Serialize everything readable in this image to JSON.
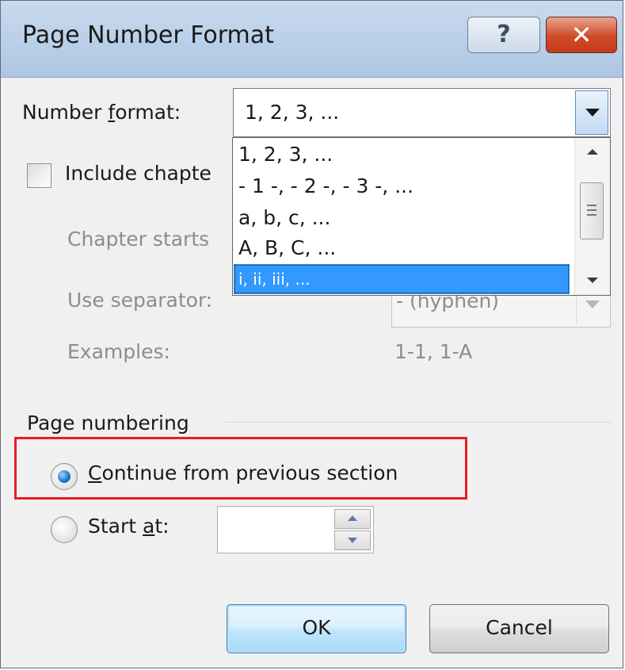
{
  "window": {
    "title": "Page Number Format"
  },
  "titlebar": {
    "help_glyph": "?",
    "close_glyph": "✕"
  },
  "number_format": {
    "label_prefix": "Number ",
    "label_accel": "f",
    "label_suffix": "ormat:",
    "selected_value": "1, 2, 3, ...",
    "options": [
      "1, 2, 3, ...",
      "- 1 -, - 2 -, - 3 -, ...",
      "a, b, c, ...",
      "A, B, C, ...",
      "i, ii, iii, ..."
    ],
    "highlighted_option": "i, ii, iii, ..."
  },
  "chapter": {
    "include_label": "Include chapte",
    "starts_label": "Chapter starts",
    "separator_label": "Use separator:",
    "separator_value": "-   (hyphen)",
    "examples_label": "Examples:",
    "examples_value": "1-1, 1-A"
  },
  "page_numbering": {
    "group_label": "Page numbering",
    "continue_accel": "C",
    "continue_rest": "ontinue from previous section",
    "start_prefix": "Start ",
    "start_accel": "a",
    "start_suffix": "t:",
    "start_value": ""
  },
  "buttons": {
    "ok": "OK",
    "cancel": "Cancel"
  },
  "colors": {
    "selection": "#3399ff",
    "highlight_box": "#ea1c24"
  }
}
